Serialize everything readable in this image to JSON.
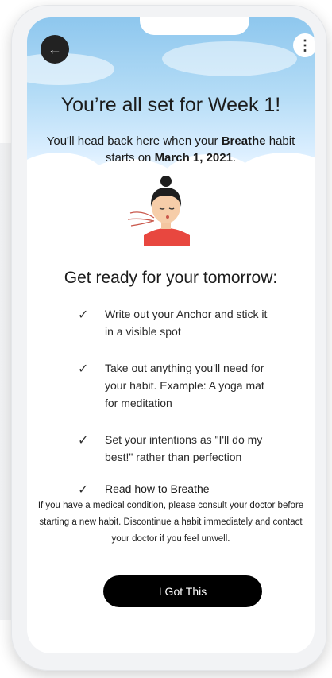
{
  "header": {
    "back_icon": "arrow-left-icon",
    "back_glyph": "←",
    "more_icon": "more-vertical-icon",
    "more_glyph": "⋮"
  },
  "hero": {
    "title": "You’re all set for Week 1!",
    "subtitle_prefix": "You'll head back here when your ",
    "habit_name": "Breathe",
    "subtitle_middle": " habit starts on ",
    "start_date": "March 1, 2021",
    "subtitle_suffix": "."
  },
  "section": {
    "title": "Get ready for your tomorrow:"
  },
  "checklist": [
    {
      "text": "Write out your Anchor and stick it in a visible spot"
    },
    {
      "text": "Take out anything you'll need for your habit. Example: A yoga mat for meditation"
    },
    {
      "text": "Set your intentions as \"I'll do my best!\" rather than perfection"
    },
    {
      "text": "Read how to Breathe"
    }
  ],
  "check_glyph": "✓",
  "disclaimer": "If you have a medical condition, please consult your doctor before starting a new habit. Discontinue a habit immediately and contact your doctor if you feel unwell.",
  "cta": {
    "label": "I Got This"
  },
  "colors": {
    "sky_top": "#8ec7ee",
    "button": "#000000",
    "text": "#1b1b1b"
  }
}
